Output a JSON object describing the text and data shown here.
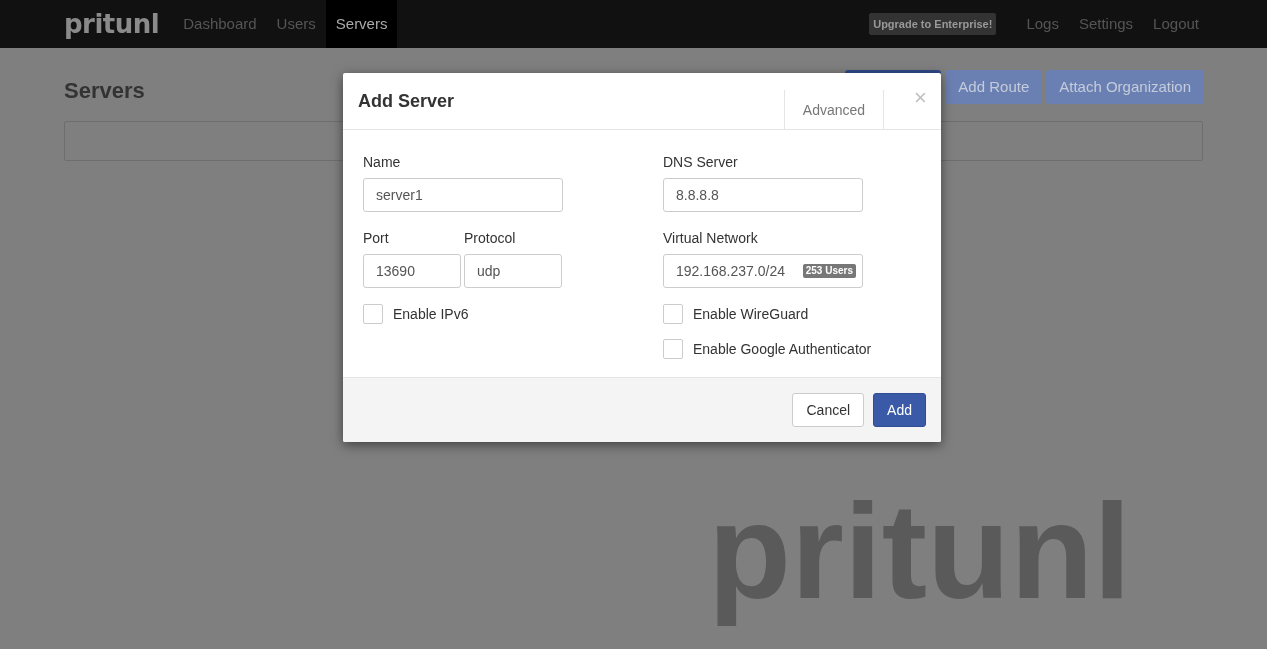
{
  "navbar": {
    "brand": "pritunl",
    "nav_items": [
      {
        "label": "Dashboard",
        "selected": false
      },
      {
        "label": "Users",
        "selected": false
      },
      {
        "label": "Servers",
        "selected": true
      }
    ],
    "upgrade_badge": "Upgrade to Enterprise!",
    "right_items": [
      "Logs",
      "Settings",
      "Logout"
    ]
  },
  "page": {
    "title": "Servers",
    "buttons": [
      {
        "kind": "primary"
      },
      {
        "label": "Add Route",
        "kind": "secondary"
      },
      {
        "label": "Attach Organization",
        "kind": "secondary"
      }
    ]
  },
  "background_logo": "pritunl",
  "dialog": {
    "title": "Add Server",
    "tabs": [
      {
        "label": "Advanced",
        "selected": false
      }
    ],
    "close": "×",
    "name": {
      "label": "Name",
      "value": "server1"
    },
    "port": {
      "label": "Port",
      "value": "13690"
    },
    "protocol": {
      "label": "Protocol",
      "value": "udp"
    },
    "dns_server": {
      "label": "DNS Server",
      "value": "8.8.8.8"
    },
    "virtual_network": {
      "label": "Virtual Network",
      "value": "192.168.237.0/24",
      "badge": "253 Users"
    },
    "left_checkboxes": [
      {
        "label": "Enable IPv6",
        "checked": false
      }
    ],
    "right_checkboxes": [
      {
        "label": "Enable WireGuard",
        "checked": false
      },
      {
        "label": "Enable Google Authenticator",
        "checked": false
      }
    ],
    "buttons": [
      {
        "label": "Cancel",
        "kind": "default"
      },
      {
        "label": "Add",
        "kind": "primary"
      }
    ]
  }
}
